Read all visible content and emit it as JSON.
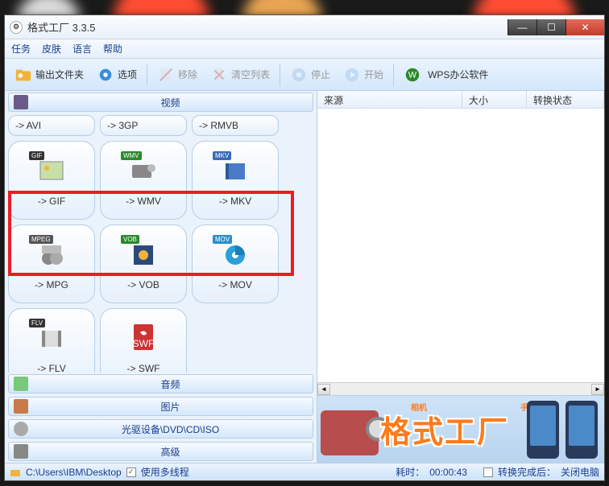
{
  "title": "格式工厂 3.3.5",
  "menu": {
    "task": "任务",
    "skin": "皮肤",
    "lang": "语言",
    "help": "帮助"
  },
  "toolbar": {
    "output_folder": "输出文件夹",
    "options": "选项",
    "remove": "移除",
    "clear": "清空列表",
    "stop": "停止",
    "start": "开始",
    "wps": "WPS办公软件"
  },
  "categories": {
    "video": "视频",
    "audio": "音频",
    "picture": "图片",
    "disc": "光驱设备\\DVD\\CD\\ISO",
    "advanced": "高级"
  },
  "formats_row1": {
    "avi": "-> AVI",
    "3gp": "-> 3GP",
    "rmvb": "-> RMVB"
  },
  "formats": {
    "gif": "-> GIF",
    "wmv": "-> WMV",
    "mkv": "-> MKV",
    "mpg": "-> MPG",
    "vob": "-> VOB",
    "mov": "-> MOV",
    "flv": "-> FLV",
    "swf": "-> SWF"
  },
  "badges": {
    "gif": "GIF",
    "wmv": "WMV",
    "mkv": "MKV",
    "mpeg": "MPEG",
    "vob": "VOB",
    "mov": "MOV",
    "flv": "FLV"
  },
  "list": {
    "col1": "来源",
    "col2": "大小",
    "col3": "转换状态"
  },
  "banner": {
    "text": "格式工厂",
    "tag1": "相机",
    "tag2": "手机"
  },
  "status": {
    "path": "C:\\Users\\IBM\\Desktop",
    "multithread": "使用多线程",
    "elapsed_label": "耗时：",
    "elapsed_value": "00:00:43",
    "after_label": "转换完成后：",
    "after_value": "关闭电脑"
  }
}
